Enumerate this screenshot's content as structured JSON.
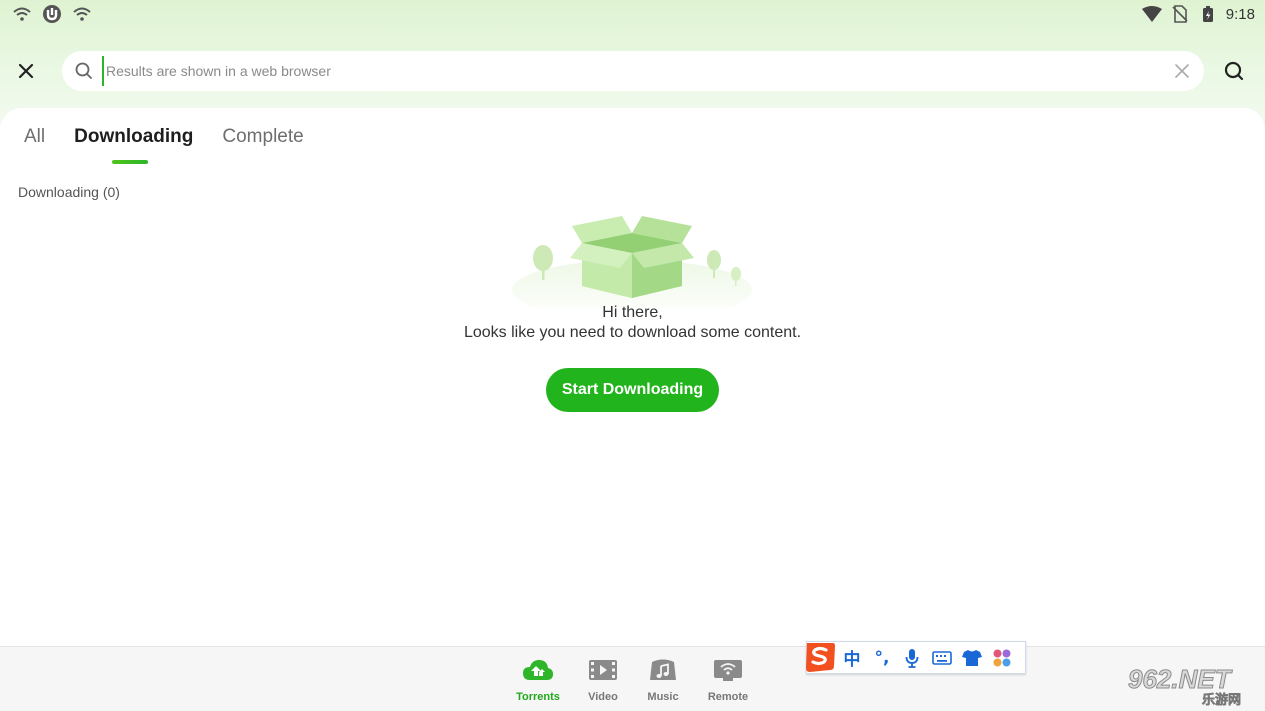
{
  "status_bar": {
    "time": "9:18",
    "left_icons": [
      "wifi-icon",
      "utorrent-icon",
      "wifi-icon"
    ],
    "right_icons": [
      "wifi-signal-icon",
      "no-sim-icon",
      "battery-icon"
    ]
  },
  "search": {
    "placeholder": "Results are shown in a web browser",
    "value": ""
  },
  "tabs": [
    {
      "label": "All",
      "active": false
    },
    {
      "label": "Downloading",
      "active": true
    },
    {
      "label": "Complete",
      "active": false
    }
  ],
  "section": {
    "count_label": "Downloading (0)"
  },
  "empty_state": {
    "line1": "Hi there,",
    "line2": "Looks like you need to download some content.",
    "button_label": "Start Downloading",
    "illustration": "open-box-icon"
  },
  "bottom_nav": [
    {
      "label": "Torrents",
      "icon": "cloud-upload-icon",
      "active": true
    },
    {
      "label": "Video",
      "icon": "film-icon",
      "active": false
    },
    {
      "label": "Music",
      "icon": "music-note-icon",
      "active": false
    },
    {
      "label": "Remote",
      "icon": "remote-wifi-icon",
      "active": false
    }
  ],
  "ime_toolbar": {
    "logo": "sogou-s-icon",
    "items": [
      {
        "text": "中",
        "name": "chinese-mode"
      },
      {
        "text": "°,",
        "name": "punctuation"
      },
      {
        "icon": "microphone-icon"
      },
      {
        "icon": "keyboard-icon"
      },
      {
        "icon": "shirt-icon"
      },
      {
        "icon": "apps-grid-icon"
      }
    ]
  },
  "watermark": {
    "line1": "962.NET",
    "line2": "乐游网"
  },
  "colors": {
    "accent": "#22b41c",
    "header_bg": "#e3f5d9",
    "tab_active": "#1e1e1e",
    "tab_inactive": "#6e6e6e",
    "nav_active": "#22a81c"
  }
}
